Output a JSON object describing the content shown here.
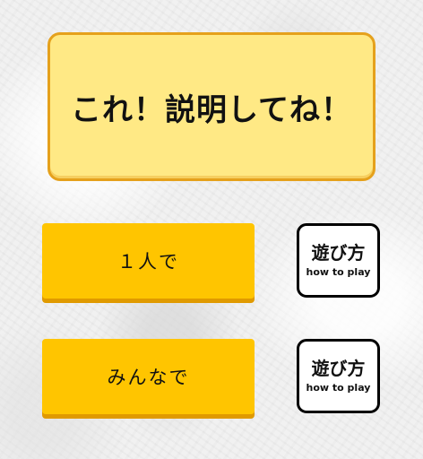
{
  "title": {
    "text": "これ！説明してね！"
  },
  "modes": [
    {
      "label": "１人で",
      "howto_jp": "遊び方",
      "howto_en": "how to play"
    },
    {
      "label": "みんなで",
      "howto_jp": "遊び方",
      "howto_en": "how to play"
    }
  ],
  "colors": {
    "title_bg": "#ffe985",
    "title_border": "#e5a11c",
    "button_bg": "#ffc500",
    "button_shadow": "#e09a00",
    "howto_bg": "#ffffff",
    "howto_border": "#000000"
  }
}
